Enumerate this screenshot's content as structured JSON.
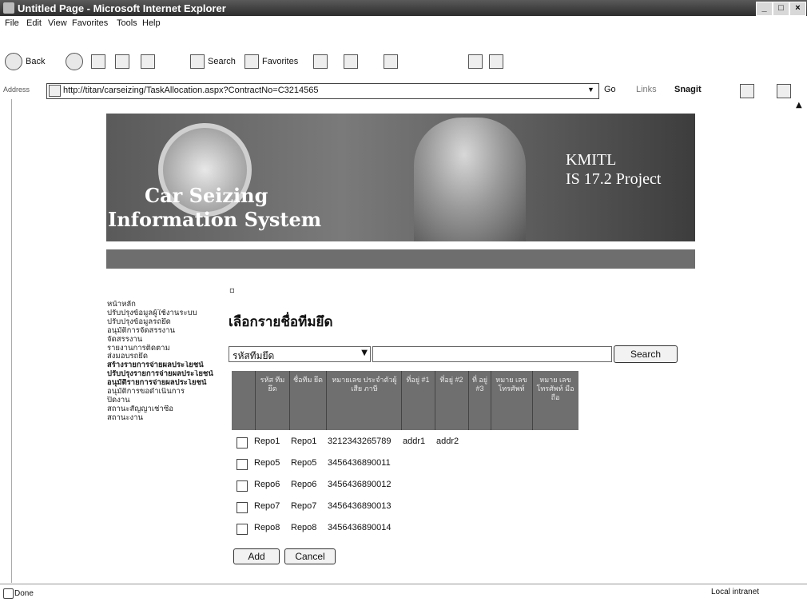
{
  "window": {
    "title": "Untitled Page - Microsoft Internet Explorer",
    "min": "_",
    "max": "□",
    "close": "×"
  },
  "menu": [
    "File",
    "Edit",
    "View",
    "Favorites",
    "Tools",
    "Help"
  ],
  "toolbar": {
    "back": "Back",
    "search": "Search",
    "favorites": "Favorites"
  },
  "address": {
    "label": "Address",
    "url": "http://titan/carseizing/TaskAllocation.aspx?ContractNo=C3214565",
    "go": "Go",
    "links": "Links",
    "snagit": "Snagit"
  },
  "banner": {
    "logo_line1": "Car Seizing",
    "logo_line2": "Information System",
    "org": "KMITL",
    "project": "IS 17.2 Project"
  },
  "sidebar": {
    "items": [
      "หน้าหลัก",
      "ปรับปรุงข้อมูลผู้ใช้งานระบบ",
      "ปรับปรุงข้อมูลรถยึด",
      "อนุมัติการจัดสรรงาน",
      "จัดสรรงาน",
      "รายงานการติดตาม",
      "ส่งมอบรถยึด",
      "สร้างรายการจ่ายผลประโยชน์",
      "ปรับปรุงรายการจ่ายผลประโยชน์",
      "อนุมัติรายการจ่ายผลประโยชน์",
      "อนุมัติการขอดำเนินการ",
      "ปิดงาน",
      "สถานะสัญญาเช่าซื้อ",
      "สถานะงาน"
    ]
  },
  "main": {
    "heading": "เลือกรายชื่อทีมยึด",
    "search": {
      "select_value": "รหัสทีมยึด",
      "input_value": "",
      "button": "Search"
    },
    "columns": [
      "รหัส ทีมยึด",
      "ชื่อทีม ยึด",
      "หมายเลข ประจำตัวผู้เสีย ภาษี",
      "ที่อยู่ #1",
      "ที่อยู่ #2",
      "ที่ อยู่ #3",
      "หมาย เลข โทรศัพท์",
      "หมาย เลข โทรศัพท์ มือถือ"
    ],
    "rows": [
      {
        "id": "Repo1",
        "name": "Repo1",
        "tax": "3212343265789",
        "addr1": "addr1",
        "addr2": "addr2"
      },
      {
        "id": "Repo5",
        "name": "Repo5",
        "tax": "3456436890011",
        "addr1": "",
        "addr2": ""
      },
      {
        "id": "Repo6",
        "name": "Repo6",
        "tax": "3456436890012",
        "addr1": "",
        "addr2": ""
      },
      {
        "id": "Repo7",
        "name": "Repo7",
        "tax": "3456436890013",
        "addr1": "",
        "addr2": ""
      },
      {
        "id": "Repo8",
        "name": "Repo8",
        "tax": "3456436890014",
        "addr1": "",
        "addr2": ""
      }
    ],
    "add_button": "Add",
    "cancel_button": "Cancel"
  },
  "status": {
    "left": "Done",
    "right": "Local intranet"
  }
}
